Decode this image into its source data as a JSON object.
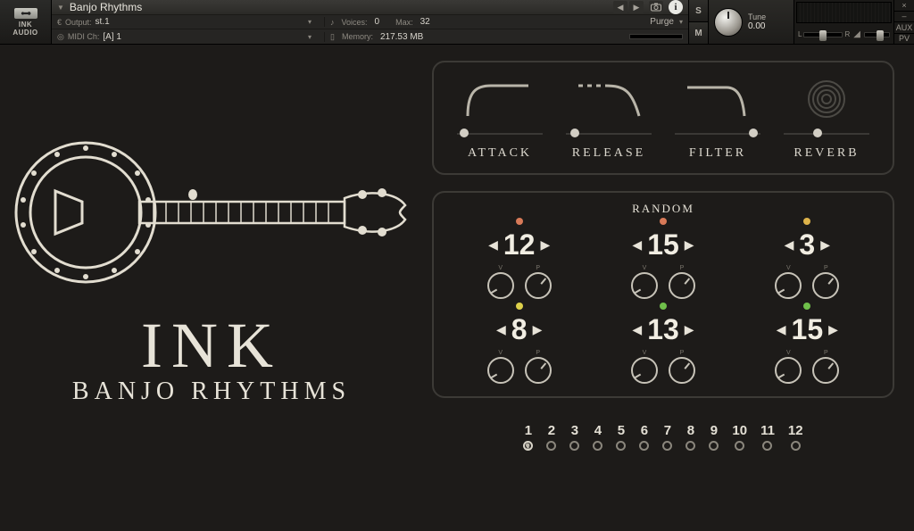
{
  "header": {
    "logo_line1": "INK",
    "logo_line2": "AUDIO",
    "instrument_title": "Banjo Rhythms",
    "output_label": "Output:",
    "output_value": "st.1",
    "midi_label": "MIDI Ch:",
    "midi_value": "[A] 1",
    "voices_label": "Voices:",
    "voices_value": "0",
    "max_label": "Max:",
    "max_value": "32",
    "memory_label": "Memory:",
    "memory_value": "217.53 MB",
    "purge_label": "Purge",
    "solo_label": "S",
    "mute_label": "M",
    "tune_label": "Tune",
    "tune_value": "0.00",
    "pan_l": "L",
    "pan_r": "R",
    "close_label": "×",
    "min_label": "–",
    "aux_label": "AUX",
    "pv_label": "PV"
  },
  "brand": {
    "ink": "INK",
    "sub": "BANJO RHYTHMS"
  },
  "sliders": {
    "attack": {
      "label": "ATTACK",
      "pos_pct": 8
    },
    "release": {
      "label": "RELEASE",
      "pos_pct": 10
    },
    "filter": {
      "label": "FILTER",
      "pos_pct": 92
    },
    "reverb": {
      "label": "REVERB",
      "pos_pct": 40
    }
  },
  "random": {
    "title": "RANDOM",
    "cells": [
      {
        "value": "12",
        "led": "#d87a58",
        "k1": "V",
        "k2": "P"
      },
      {
        "value": "15",
        "led": "#d87a58",
        "k1": "V",
        "k2": "P"
      },
      {
        "value": "3",
        "led": "#ddb34a",
        "k1": "V",
        "k2": "P"
      },
      {
        "value": "8",
        "led": "#ddd04a",
        "k1": "V",
        "k2": "P"
      },
      {
        "value": "13",
        "led": "#6fbf4a",
        "k1": "V",
        "k2": "P"
      },
      {
        "value": "15",
        "led": "#6fbf4a",
        "k1": "V",
        "k2": "P"
      }
    ]
  },
  "steps": {
    "numbers": [
      "1",
      "2",
      "3",
      "4",
      "5",
      "6",
      "7",
      "8",
      "9",
      "10",
      "11",
      "12"
    ],
    "active_index": 0
  }
}
